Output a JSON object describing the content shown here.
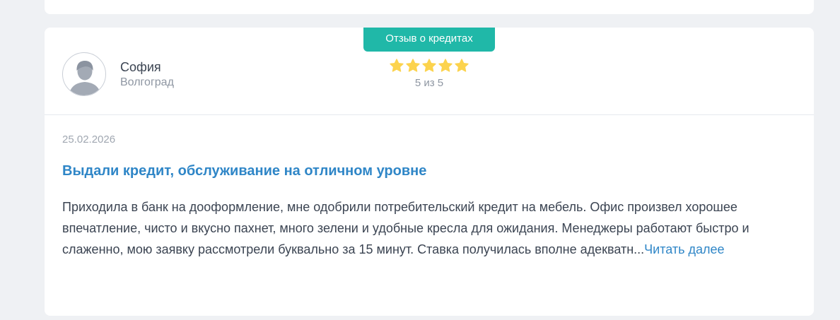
{
  "review": {
    "category_badge": "Отзыв о кредитах",
    "author": {
      "name": "София",
      "city": "Волгоград"
    },
    "rating": {
      "value": 5,
      "max": 5,
      "label": "5 из 5",
      "star_color": "#fcd34d"
    },
    "date": "25.02.2026",
    "title": "Выдали кредит, обслуживание на отличном уровне",
    "text": "Приходила в банк на дооформление, мне одобрили потребительский кредит на мебель. Офис произвел хорошее впечатление, чисто и вкусно пахнет, много зелени и удобные кресла для ожидания. Менеджеры работают быстро и слаженно, мою заявку рассмотрели буквально за 15 минут. Ставка получилась вполне адекватн...",
    "read_more": "Читать далее"
  },
  "colors": {
    "badge": "#20b8a8",
    "link": "#2f86c7",
    "background": "#eff1f4"
  }
}
